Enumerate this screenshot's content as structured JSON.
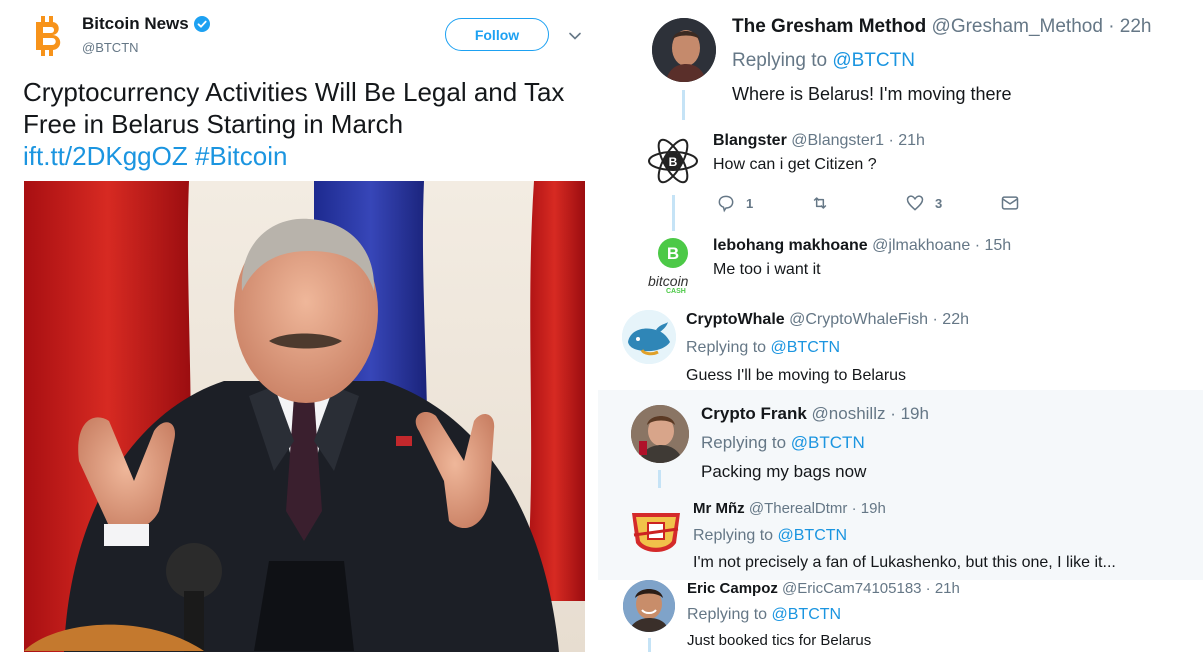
{
  "tweet": {
    "author": "Bitcoin News",
    "handle": "@BTCTN",
    "follow_label": "Follow",
    "text": "Cryptocurrency Activities Will Be Legal and Tax Free in Belarus Starting in March",
    "link": "ift.tt/2DKggOZ",
    "hashtag": "#Bitcoin"
  },
  "replies": [
    {
      "name": "The Gresham Method",
      "handle": "@Gresham_Method",
      "time": "· 22h",
      "replying_prefix": "Replying to",
      "replying_to": "@BTCTN",
      "text": "Where is Belarus! I'm moving there"
    },
    {
      "name": "Blangster",
      "handle": "@Blangster1",
      "time": "· 21h",
      "text": "How can i get Citizen ?",
      "reply_count": "1",
      "like_count": "3"
    },
    {
      "name": "lebohang makhoane",
      "handle": "@jlmakhoane",
      "time": "· 15h",
      "text": "Me too i want it",
      "avatar_text": "bitcoin",
      "avatar_subtext": "CASH"
    },
    {
      "name": "CryptoWhale",
      "handle": "@CryptoWhaleFish",
      "time": "· 22h",
      "replying_prefix": "Replying to",
      "replying_to": "@BTCTN",
      "text": "Guess I'll be moving to Belarus"
    },
    {
      "name": "Crypto Frank",
      "handle": "@noshillz",
      "time": "· 19h",
      "replying_prefix": "Replying to",
      "replying_to": "@BTCTN",
      "text": "Packing my bags now"
    },
    {
      "name": "Mr Mñz",
      "handle": "@TherealDtmr",
      "time": "· 19h",
      "replying_prefix": "Replying to",
      "replying_to": "@BTCTN",
      "text": "I'm not precisely a fan of Lukashenko, but this one, I like it..."
    },
    {
      "name": "Eric Campoz",
      "handle": "@EricCam74105183",
      "time": "· 21h",
      "replying_prefix": "Replying to",
      "replying_to": "@BTCTN",
      "text": "Just booked tics for Belarus"
    }
  ],
  "colors": {
    "accent": "#1da1f2",
    "link": "#1b95e0",
    "muted": "#657786",
    "bitcoin_orange": "#f7931a",
    "bitcoin_cash_green": "#4cc947"
  }
}
